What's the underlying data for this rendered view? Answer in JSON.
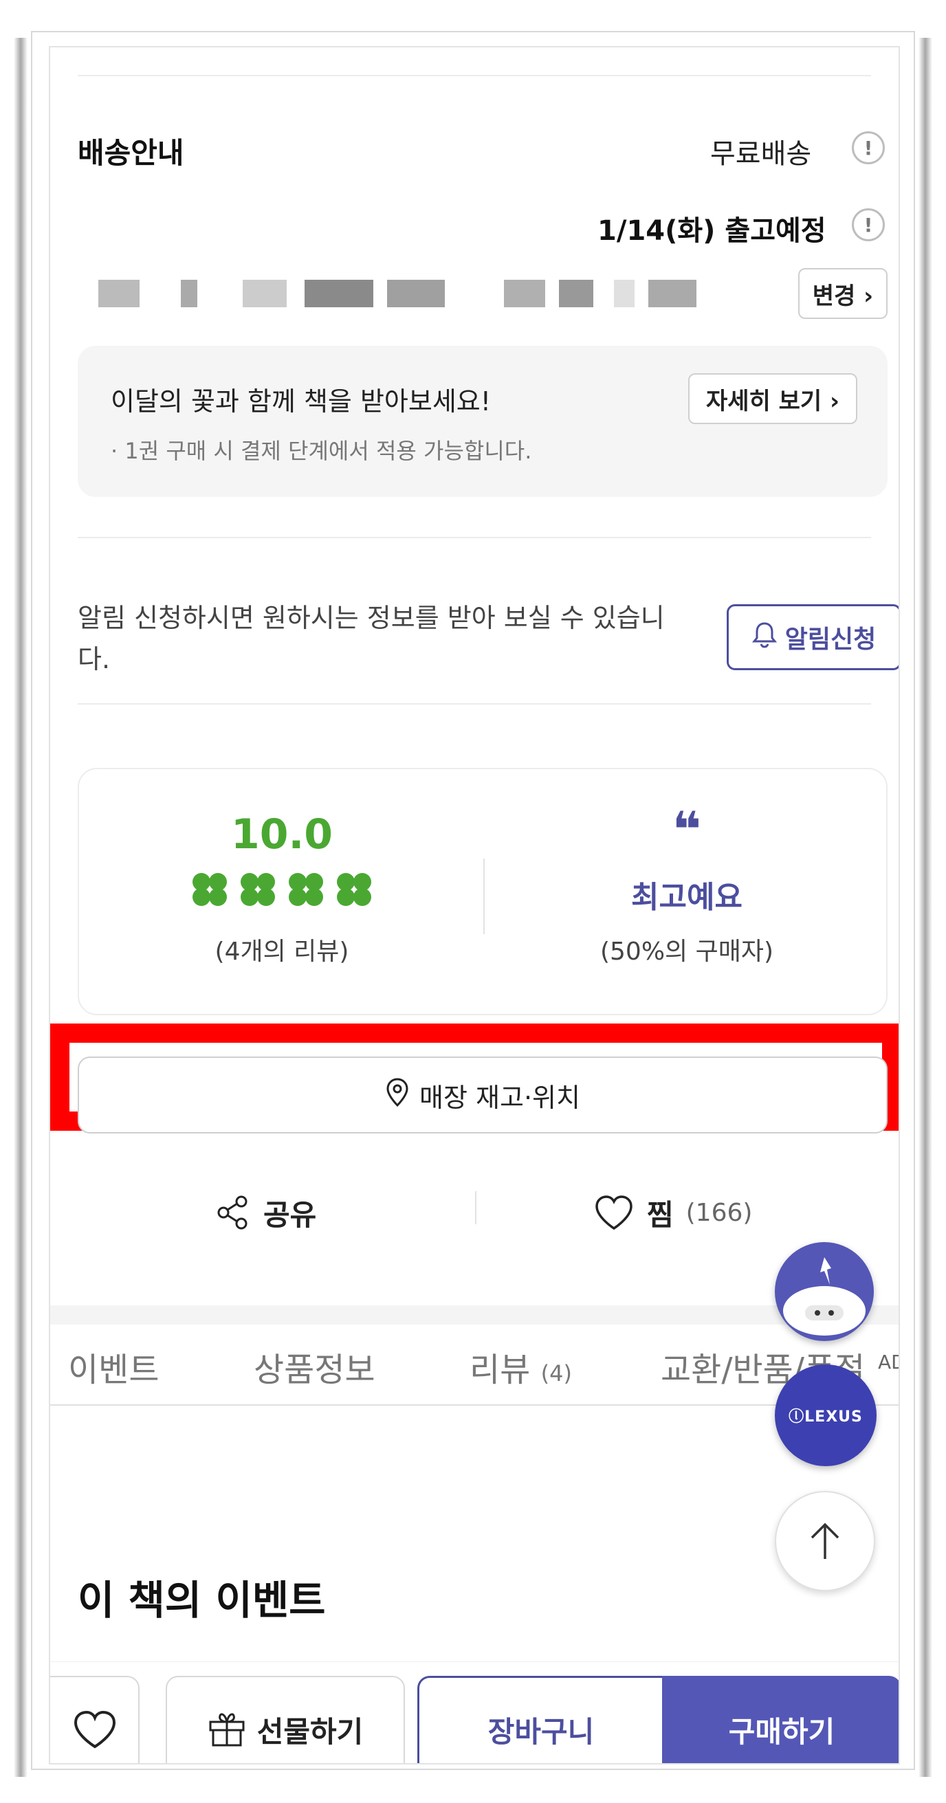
{
  "delivery": {
    "title": "배송안내",
    "shipping_label": "무료배송",
    "ship_date": "1/14(화) 출고예정",
    "info_glyph": "!",
    "change_label": "변경 ›"
  },
  "promo": {
    "title": "이달의 꽃과 함께 책을 받아보세요!",
    "sub": "· 1권 구매 시 결제 단계에서 적용 가능합니다.",
    "detail_label": "자세히 보기 ›"
  },
  "notify": {
    "text": "알림 신청하시면 원하시는 정보를 받아 보실 수 있습니다.",
    "button_label": "알림신청"
  },
  "review": {
    "score": "10.0",
    "rating_level": 1.0,
    "count": "(4개의 리뷰)",
    "quote": "❝",
    "best": "최고예요",
    "buyer_pct": "(50%의 구매자)"
  },
  "store": {
    "button_label": "매장 재고·위치"
  },
  "actions": {
    "share_label": "공유",
    "like_label": "찜",
    "like_count": "(166)"
  },
  "tabs": [
    {
      "label": "이벤트",
      "count": ""
    },
    {
      "label": "상품정보",
      "count": ""
    },
    {
      "label": "리뷰",
      "count": "(4)"
    },
    {
      "label": "교환/반품/품절",
      "count": ""
    }
  ],
  "section": {
    "title": "이 책의 이벤트"
  },
  "floating": {
    "ad_tag": "AD",
    "lexus_logo": "ⓛLEXUS"
  },
  "bottom_bar": {
    "gift_label": "선물하기",
    "cart_label": "장바구니",
    "buy_label": "구매하기"
  },
  "colors": {
    "accent": "#4c4e9e",
    "buy_bg": "#5457b6",
    "rating_green": "#4aa832",
    "highlight_red": "#ff0000"
  },
  "icons": [
    "info-icon",
    "bell-icon",
    "clover-icon",
    "location-pin-icon",
    "share-icon",
    "heart-icon",
    "gift-icon",
    "arrow-up-icon",
    "mascot-icon"
  ]
}
